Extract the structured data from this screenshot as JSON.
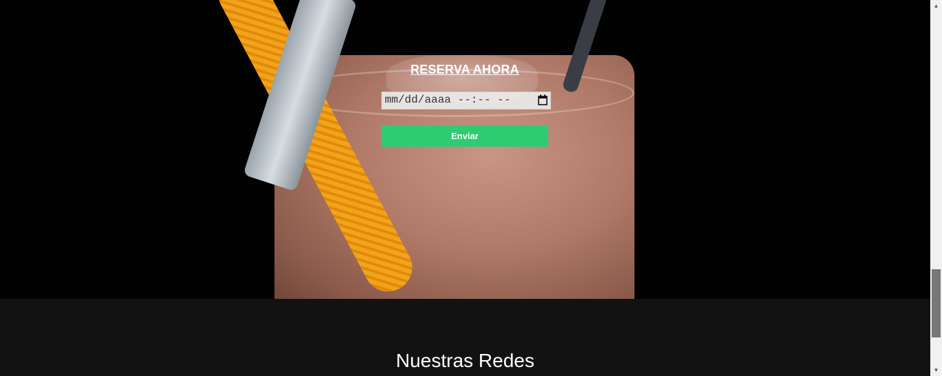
{
  "reservation": {
    "title": "RESERVA AHORA",
    "date_placeholder": "mm/dd/aaaa --:-- --",
    "submit_label": "Enviar"
  },
  "footer": {
    "title": "Nuestras Redes"
  },
  "colors": {
    "button_bg": "#2ecc71",
    "footer_bg": "#121212",
    "hero_bg": "#020202"
  },
  "icons": {
    "calendar": "calendar-icon",
    "scroll_up": "chevron-up-icon",
    "scroll_down": "chevron-down-icon"
  }
}
